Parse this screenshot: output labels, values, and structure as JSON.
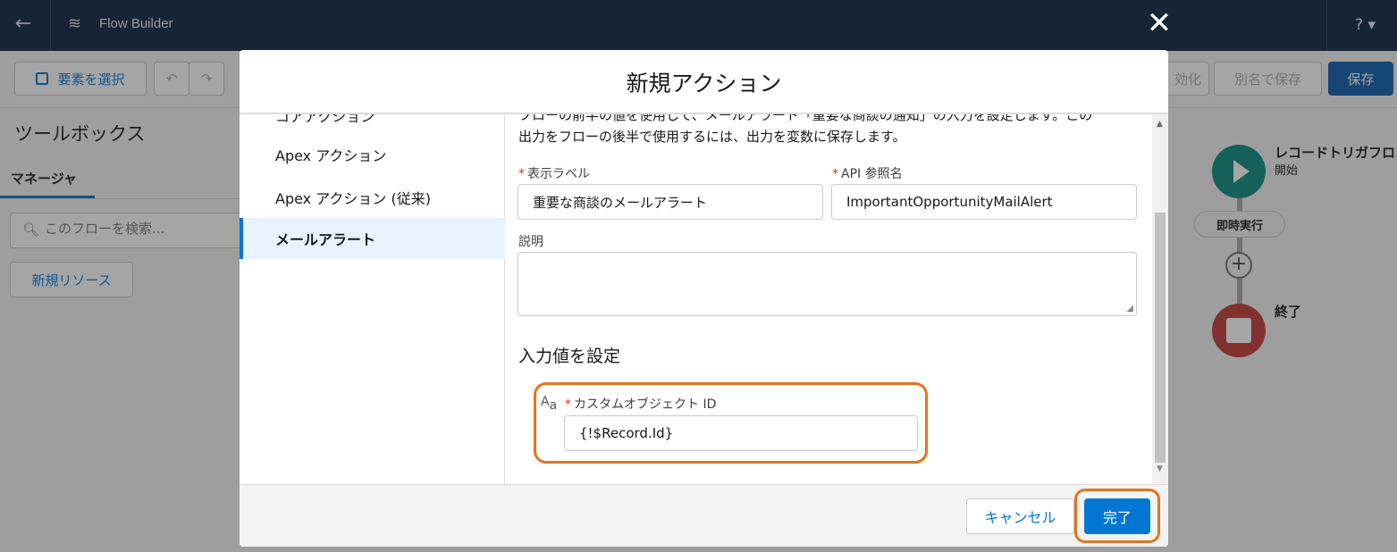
{
  "topbar": {
    "back_icon": "arrow-left-icon",
    "logo_icon": "flow-icon",
    "title": "Flow Builder",
    "help_label": "? ▾"
  },
  "toolbar": {
    "select_label": "要素を選択",
    "undo_icon": "↶",
    "redo_icon": "↷",
    "activate_label": "効化",
    "save_as_label": "別名で保存",
    "save_label": "保存"
  },
  "toolbox": {
    "title": "ツールボックス",
    "tab_manager": "マネージャ",
    "search_placeholder": "このフローを検索...",
    "new_resource_label": "新規リソース"
  },
  "canvas": {
    "start_title": "レコードトリガフロ",
    "start_sub": "開始",
    "badge": "即時実行",
    "plus": "+",
    "end_label": "終了"
  },
  "modal": {
    "close_icon": "✕",
    "title": "新規アクション",
    "nav": {
      "cut_item": "コアアクション",
      "apex": "Apex アクション",
      "apex_old": "Apex アクション (従来)",
      "mail": "メールアラート"
    },
    "desc_line1": "フローの前半の値を使用して、メールアラート「重要な商談の通知」の入力を設定します。この",
    "desc_line2": "出力をフローの後半で使用するには、出力を変数に保存します。",
    "required_mark": "*",
    "display_label_label": "表示ラベル",
    "display_label_value": "重要な商談のメールアラート",
    "api_name_label": "API 参照名",
    "api_name_value": "ImportantOpportunityMailAlert",
    "description_label": "説明",
    "section_title": "入力値を設定",
    "custom_object_label": "カスタムオブジェクト ID",
    "custom_object_value": "{!$Record.Id}",
    "type_icon_main": "A",
    "type_icon_sub": "a",
    "cancel_label": "キャンセル",
    "done_label": "完了"
  },
  "colors": {
    "topbar": "#0b2241",
    "brand_blue": "#0176d3",
    "highlight_orange": "#e8721c",
    "start_node": "#0a8a7e",
    "end_node": "#c23934"
  }
}
